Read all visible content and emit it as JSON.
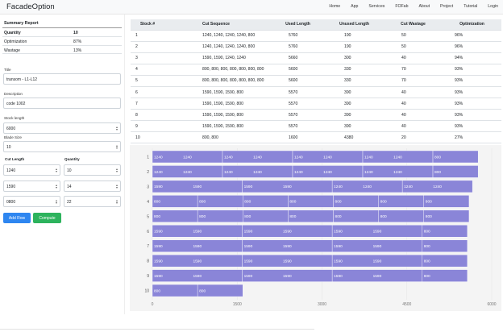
{
  "navbar": {
    "brand": "FacadeOption",
    "links": [
      "Home",
      "App",
      "Services",
      "FOFab",
      "About",
      "Project",
      "Tutorial",
      "Login"
    ]
  },
  "summary": {
    "title": "Summary Report",
    "rows": [
      {
        "label": "Quantity",
        "value": "10"
      },
      {
        "label": "Optimization",
        "value": "87%"
      },
      {
        "label": "Wastage",
        "value": "13%"
      }
    ]
  },
  "form": {
    "title_label": "Title",
    "title_value": "transom - L1-L12",
    "description_label": "Description",
    "description_value": "code 1002",
    "stock_length_label": "Stock length",
    "stock_length_value": "6000",
    "blade_size_label": "Blade Size",
    "blade_size_value": "10",
    "cut_length_header": "Cut Length",
    "quantity_header": "Quantity",
    "cuts": [
      {
        "length": "1240",
        "quantity": "10"
      },
      {
        "length": "1590",
        "quantity": "14"
      },
      {
        "length": "0800",
        "quantity": "22"
      }
    ],
    "add_row_label": "Add Row",
    "compute_label": "Compute"
  },
  "table": {
    "headers": [
      "Stock #",
      "Cut Sequence",
      "Used Length",
      "Unused Length",
      "Cut Wastage",
      "Optimization"
    ],
    "rows": [
      [
        "1",
        "1240, 1240, 1240, 1240, 800",
        "5760",
        "190",
        "50",
        "96%"
      ],
      [
        "2",
        "1240, 1240, 1240, 1240, 800",
        "5760",
        "190",
        "50",
        "96%"
      ],
      [
        "3",
        "1590, 1590, 1240, 1240",
        "5660",
        "300",
        "40",
        "94%"
      ],
      [
        "4",
        "800, 800, 800, 800, 800, 800, 800",
        "5600",
        "330",
        "70",
        "93%"
      ],
      [
        "5",
        "800, 800, 800, 800, 800, 800, 800",
        "5600",
        "330",
        "70",
        "93%"
      ],
      [
        "6",
        "1590, 1590, 1590, 800",
        "5570",
        "390",
        "40",
        "93%"
      ],
      [
        "7",
        "1590, 1590, 1590, 800",
        "5570",
        "390",
        "40",
        "93%"
      ],
      [
        "8",
        "1590, 1590, 1590, 800",
        "5570",
        "390",
        "40",
        "93%"
      ],
      [
        "9",
        "1590, 1590, 1590, 800",
        "5570",
        "390",
        "40",
        "93%"
      ],
      [
        "10",
        "800, 800",
        "1600",
        "4380",
        "20",
        "27%"
      ]
    ]
  },
  "chart_data": {
    "type": "bar",
    "orientation": "horizontal",
    "stacked": true,
    "categories": [
      "1",
      "2",
      "3",
      "4",
      "5",
      "6",
      "7",
      "8",
      "9",
      "10"
    ],
    "segments": [
      [
        1240,
        1240,
        1240,
        1240,
        800
      ],
      [
        1240,
        1240,
        1240,
        1240,
        800
      ],
      [
        1590,
        1590,
        1240,
        1240
      ],
      [
        800,
        800,
        800,
        800,
        800,
        800,
        800
      ],
      [
        800,
        800,
        800,
        800,
        800,
        800,
        800
      ],
      [
        1590,
        1590,
        1590,
        800
      ],
      [
        1590,
        1590,
        1590,
        800
      ],
      [
        1590,
        1590,
        1590,
        800
      ],
      [
        1590,
        1590,
        1590,
        800
      ],
      [
        800,
        800
      ]
    ],
    "xlim": [
      0,
      6000
    ],
    "xticks": [
      "0",
      "1500",
      "3000",
      "4500",
      "6000"
    ],
    "bar_color": "#8a85d8",
    "segment_border_color": "#ffffff",
    "background": "#f4f4f4"
  }
}
